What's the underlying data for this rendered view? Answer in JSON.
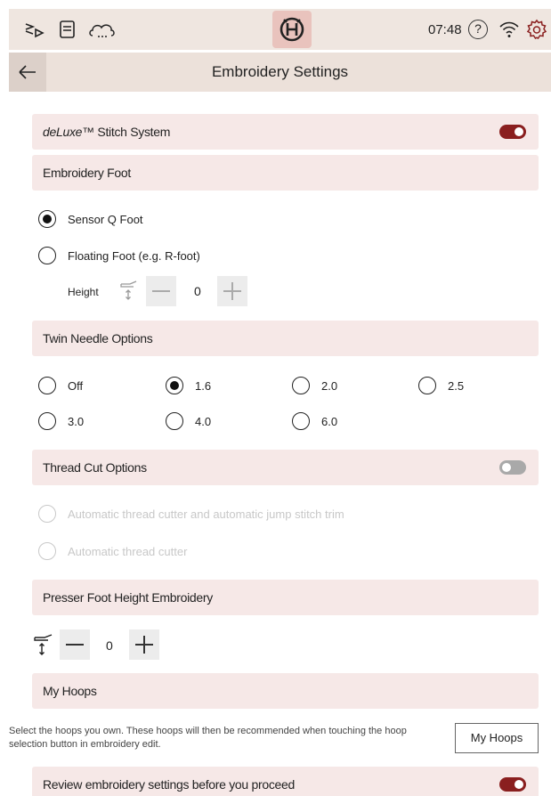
{
  "status_bar": {
    "time": "07:48",
    "help_symbol": "?",
    "icons": [
      "sew-mode-icon",
      "document-icon",
      "cloud-icon",
      "brand-logo-icon",
      "help-icon",
      "wifi-icon",
      "settings-icon"
    ],
    "accent_color": "#e9c3bd"
  },
  "header": {
    "title": "Embroidery Settings"
  },
  "deluxe": {
    "label_italic": "deLuxe",
    "label_rest": "™ Stitch System",
    "enabled": true
  },
  "embroidery_foot": {
    "title": "Embroidery Foot",
    "options": [
      "Sensor Q Foot",
      "Floating Foot (e.g. R-foot)"
    ],
    "selected": "Sensor Q Foot",
    "height_label": "Height",
    "height_value": "0"
  },
  "twin_needle": {
    "title": "Twin Needle Options",
    "options": [
      "Off",
      "1.6",
      "2.0",
      "2.5",
      "3.0",
      "4.0",
      "6.0"
    ],
    "selected": "1.6"
  },
  "thread_cut": {
    "title": "Thread Cut Options",
    "enabled": false,
    "options": [
      "Automatic thread cutter and automatic jump stitch trim",
      "Automatic thread cutter"
    ]
  },
  "presser_foot": {
    "title": "Presser Foot Height Embroidery",
    "value": "0"
  },
  "my_hoops": {
    "title": "My Hoops",
    "description": "Select the hoops you own. These hoops will then be recommended when touching the hoop selection button in embroidery edit.",
    "button_label": "My Hoops"
  },
  "review": {
    "label": "Review embroidery settings before you proceed",
    "enabled": true
  },
  "colors": {
    "toggle_on": "#8a1f1f",
    "toggle_off": "#a9a9a9",
    "section_bg": "#f6e8e7"
  }
}
